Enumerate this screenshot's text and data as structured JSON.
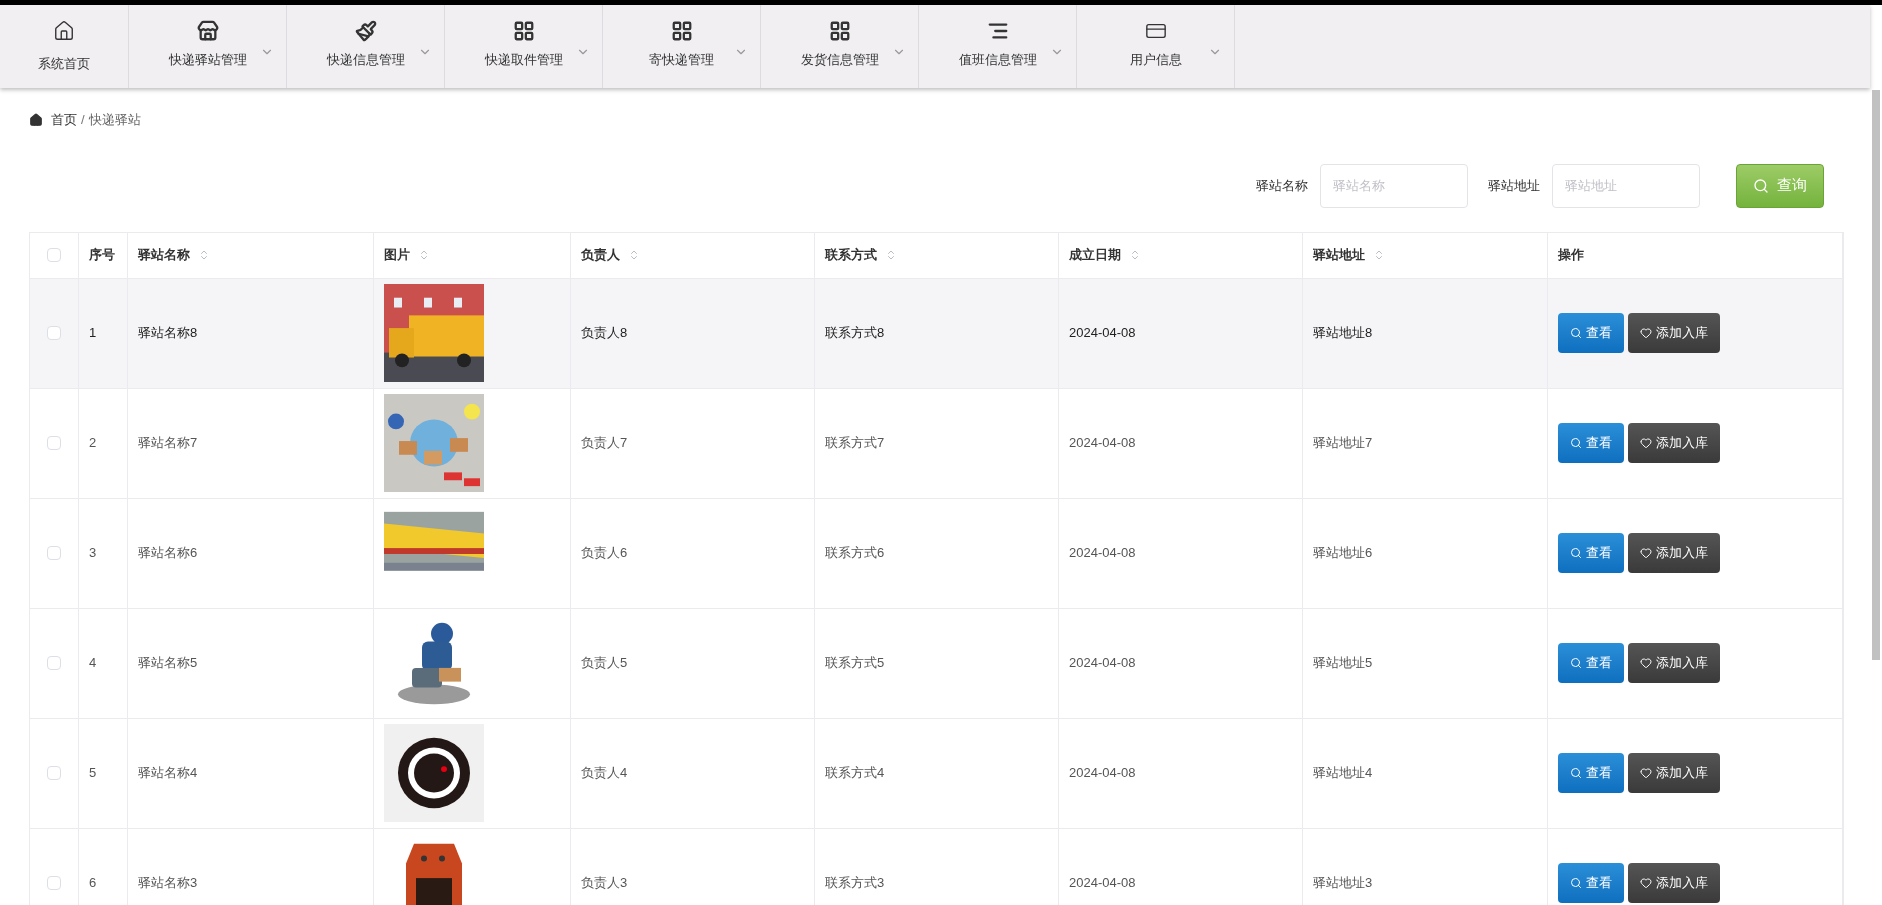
{
  "nav": [
    {
      "label": "系统首页",
      "dropdown": false
    },
    {
      "label": "快递驿站管理",
      "dropdown": true
    },
    {
      "label": "快递信息管理",
      "dropdown": true
    },
    {
      "label": "快递取件管理",
      "dropdown": true
    },
    {
      "label": "寄快递管理",
      "dropdown": true
    },
    {
      "label": "发货信息管理",
      "dropdown": true
    },
    {
      "label": "值班信息管理",
      "dropdown": true
    },
    {
      "label": "用户信息",
      "dropdown": true
    }
  ],
  "breadcrumb": {
    "items": [
      "首页",
      "快递驿站"
    ],
    "separator": "/"
  },
  "search": {
    "fields": [
      {
        "label": "驿站名称",
        "placeholder": "驿站名称"
      },
      {
        "label": "驿站地址",
        "placeholder": "驿站地址"
      }
    ],
    "button": "查询"
  },
  "table": {
    "select_all": {
      "checked": false
    },
    "columns": [
      {
        "label": "序号",
        "sortable": false
      },
      {
        "label": "驿站名称",
        "sortable": true
      },
      {
        "label": "图片",
        "sortable": true
      },
      {
        "label": "负责人",
        "sortable": true
      },
      {
        "label": "联系方式",
        "sortable": true
      },
      {
        "label": "成立日期",
        "sortable": true
      },
      {
        "label": "驿站地址",
        "sortable": true
      },
      {
        "label": "操作",
        "sortable": false
      }
    ],
    "rows": [
      {
        "checked": false,
        "hovered": true,
        "cells": [
          "1",
          "驿站名称8",
          {
            "kind": "picture"
          },
          "负责人8",
          "联系方式8",
          "2024-04-08",
          "驿站地址8"
        ],
        "actions": [
          "查看",
          "添加入库"
        ]
      },
      {
        "checked": false,
        "hovered": false,
        "cells": [
          "2",
          "驿站名称7",
          {
            "kind": "picture"
          },
          "负责人7",
          "联系方式7",
          "2024-04-08",
          "驿站地址7"
        ],
        "actions": [
          "查看",
          "添加入库"
        ]
      },
      {
        "checked": false,
        "hovered": false,
        "cells": [
          "3",
          "驿站名称6",
          {
            "kind": "picture"
          },
          "负责人6",
          "联系方式6",
          "2024-04-08",
          "驿站地址6"
        ],
        "actions": [
          "查看",
          "添加入库"
        ]
      },
      {
        "checked": false,
        "hovered": false,
        "cells": [
          "4",
          "驿站名称5",
          {
            "kind": "picture"
          },
          "负责人5",
          "联系方式5",
          "2024-04-08",
          "驿站地址5"
        ],
        "actions": [
          "查看",
          "添加入库"
        ]
      },
      {
        "checked": false,
        "hovered": false,
        "cells": [
          "5",
          "驿站名称4",
          {
            "kind": "picture"
          },
          "负责人4",
          "联系方式4",
          "2024-04-08",
          "驿站地址4"
        ],
        "actions": [
          "查看",
          "添加入库"
        ]
      },
      {
        "checked": false,
        "hovered": false,
        "cells": [
          "6",
          "驿站名称3",
          {
            "kind": "picture"
          },
          "负责人3",
          "联系方式3",
          "2024-04-08",
          "驿站地址3"
        ],
        "actions": [
          "查看",
          "添加入库"
        ]
      }
    ]
  }
}
